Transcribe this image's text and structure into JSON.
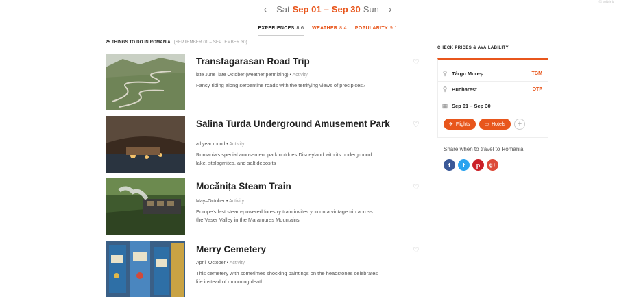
{
  "watermark": "© wikirik",
  "date_nav": {
    "start_day": "Sat",
    "start_date": "Sep 01",
    "separator": "–",
    "end_date": "Sep 30",
    "end_day": "Sun"
  },
  "tabs": [
    {
      "label": "Experiences",
      "count": "8.6"
    },
    {
      "label": "Weather",
      "count": "8.4"
    },
    {
      "label": "Popularity",
      "count": "9.1"
    }
  ],
  "list_header": {
    "title": "25 things to do in Romania",
    "range": "(September 01 – September 30)"
  },
  "items": [
    {
      "name": "Transfagarasan Road Trip",
      "when": "late June–late October (weather permitting)",
      "type": "Activity",
      "desc": "Fancy riding along serpentine roads with the terrifying views of precipices?"
    },
    {
      "name": "Salina Turda Underground Amusement Park",
      "when": "all year round",
      "type": "Activity",
      "desc": "Romania's special amusement park outdoes Disneyland with its underground lake, stalagmites, and salt deposits"
    },
    {
      "name": "Mocănița Steam Train",
      "when": "May–October",
      "type": "Activity",
      "desc": "Europe's last steam-powered forestry train invites you on a vintage trip across the Vaser Valley in the Maramures Mountains"
    },
    {
      "name": "Merry Cemetery",
      "when": "April–October",
      "type": "Activity",
      "desc": "This cemetery with sometimes shocking paintings on the headstones celebrates life instead of mourning death"
    }
  ],
  "sidebar": {
    "title": "Check prices & availability",
    "origin": "Târgu Mureș",
    "origin_code": "TGM",
    "destination": "Bucharest",
    "destination_code": "OTP",
    "dates": "Sep 01 – Sep 30",
    "flights_label": "Flights",
    "hotels_label": "Hotels",
    "plus": "+"
  },
  "share": {
    "text": "Share when to travel to Romania",
    "icons": [
      {
        "name": "facebook-icon",
        "glyph": "f",
        "color": "#3b5998"
      },
      {
        "name": "twitter-icon",
        "glyph": "t",
        "color": "#2aa3ef"
      },
      {
        "name": "pinterest-icon",
        "glyph": "p",
        "color": "#cb2027"
      },
      {
        "name": "googleplus-icon",
        "glyph": "g+",
        "color": "#dd4b39"
      }
    ]
  },
  "colors": {
    "accent": "#e8561c"
  }
}
